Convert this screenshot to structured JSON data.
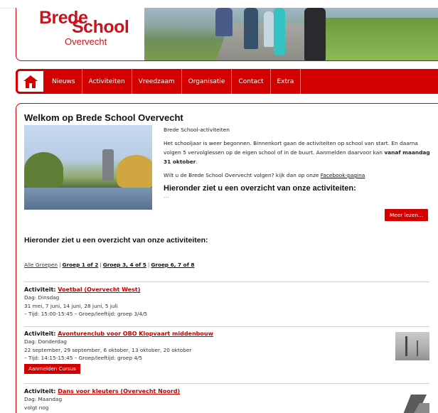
{
  "logo": {
    "brede": "Brede",
    "school": "School",
    "overvecht": "Overvecht"
  },
  "nav": {
    "items": [
      "Nieuws",
      "Activiteiten",
      "Vreedzaam",
      "Organisatie",
      "Contact",
      "Extra"
    ]
  },
  "intro": {
    "title": "Welkom op Brede School Overvecht",
    "subtitle": "Brede School-activiteiten",
    "paragraph1": "Het schooljaar is weer begonnen. Binnenkort gaan de activiteiten op school van start. En daarna volgen 5 vervolglessen op de eigen school of in de buurt. Aanmelden daarvoor kan",
    "paragraph1_bold": "vanaf maandag 31 oktober",
    "paragraph1_end": ".",
    "paragraph2": "Wilt u de Brede School Overvecht volgen? kijk dan op onze",
    "facebook_link": "Facebook-pagina",
    "heading": "Hieronder ziet u een overzicht van onze activiteiten:",
    "ellipsis": "...",
    "more_button": "Meer lezen..."
  },
  "overview_heading": "Hieronder ziet u een overzicht van onze activiteiten:",
  "filters": {
    "items": [
      "Alle Groepen",
      "Groep 1 of 2",
      "Groep 3, 4 of 5",
      "Groep 6, 7 of 8"
    ],
    "separator": "|"
  },
  "activities": [
    {
      "prefix": "Activiteit:",
      "name": "Voetbal (Overvecht West)",
      "day": "Dag: Dinsdag",
      "dates": "31 mei, 7 juni, 14 juni, 28 juni, 5 juli",
      "time": "– Tijd: 15:00-15:45 – Groep/leeftijd: groep 3/4/5"
    },
    {
      "prefix": "Activiteit:",
      "name": "Avonturenclub voor OBO Klopvaart middenbouw",
      "day": "Dag: Donderdag",
      "dates": "22 september, 29 september, 6 oktober, 13 oktober, 20 oktober",
      "time": "– Tijd: 14:15-15:45 – Groep/leeftijd: groep 4/5",
      "button": "Aanmelden Cursus"
    },
    {
      "prefix": "Activiteit:",
      "name": "Dans voor kleuters (Overvecht Noord)",
      "day": "Dag: Maandag",
      "dates": "volgt nog"
    }
  ],
  "colors": {
    "brand_red": "#d40000",
    "link_red": "#c40000"
  }
}
